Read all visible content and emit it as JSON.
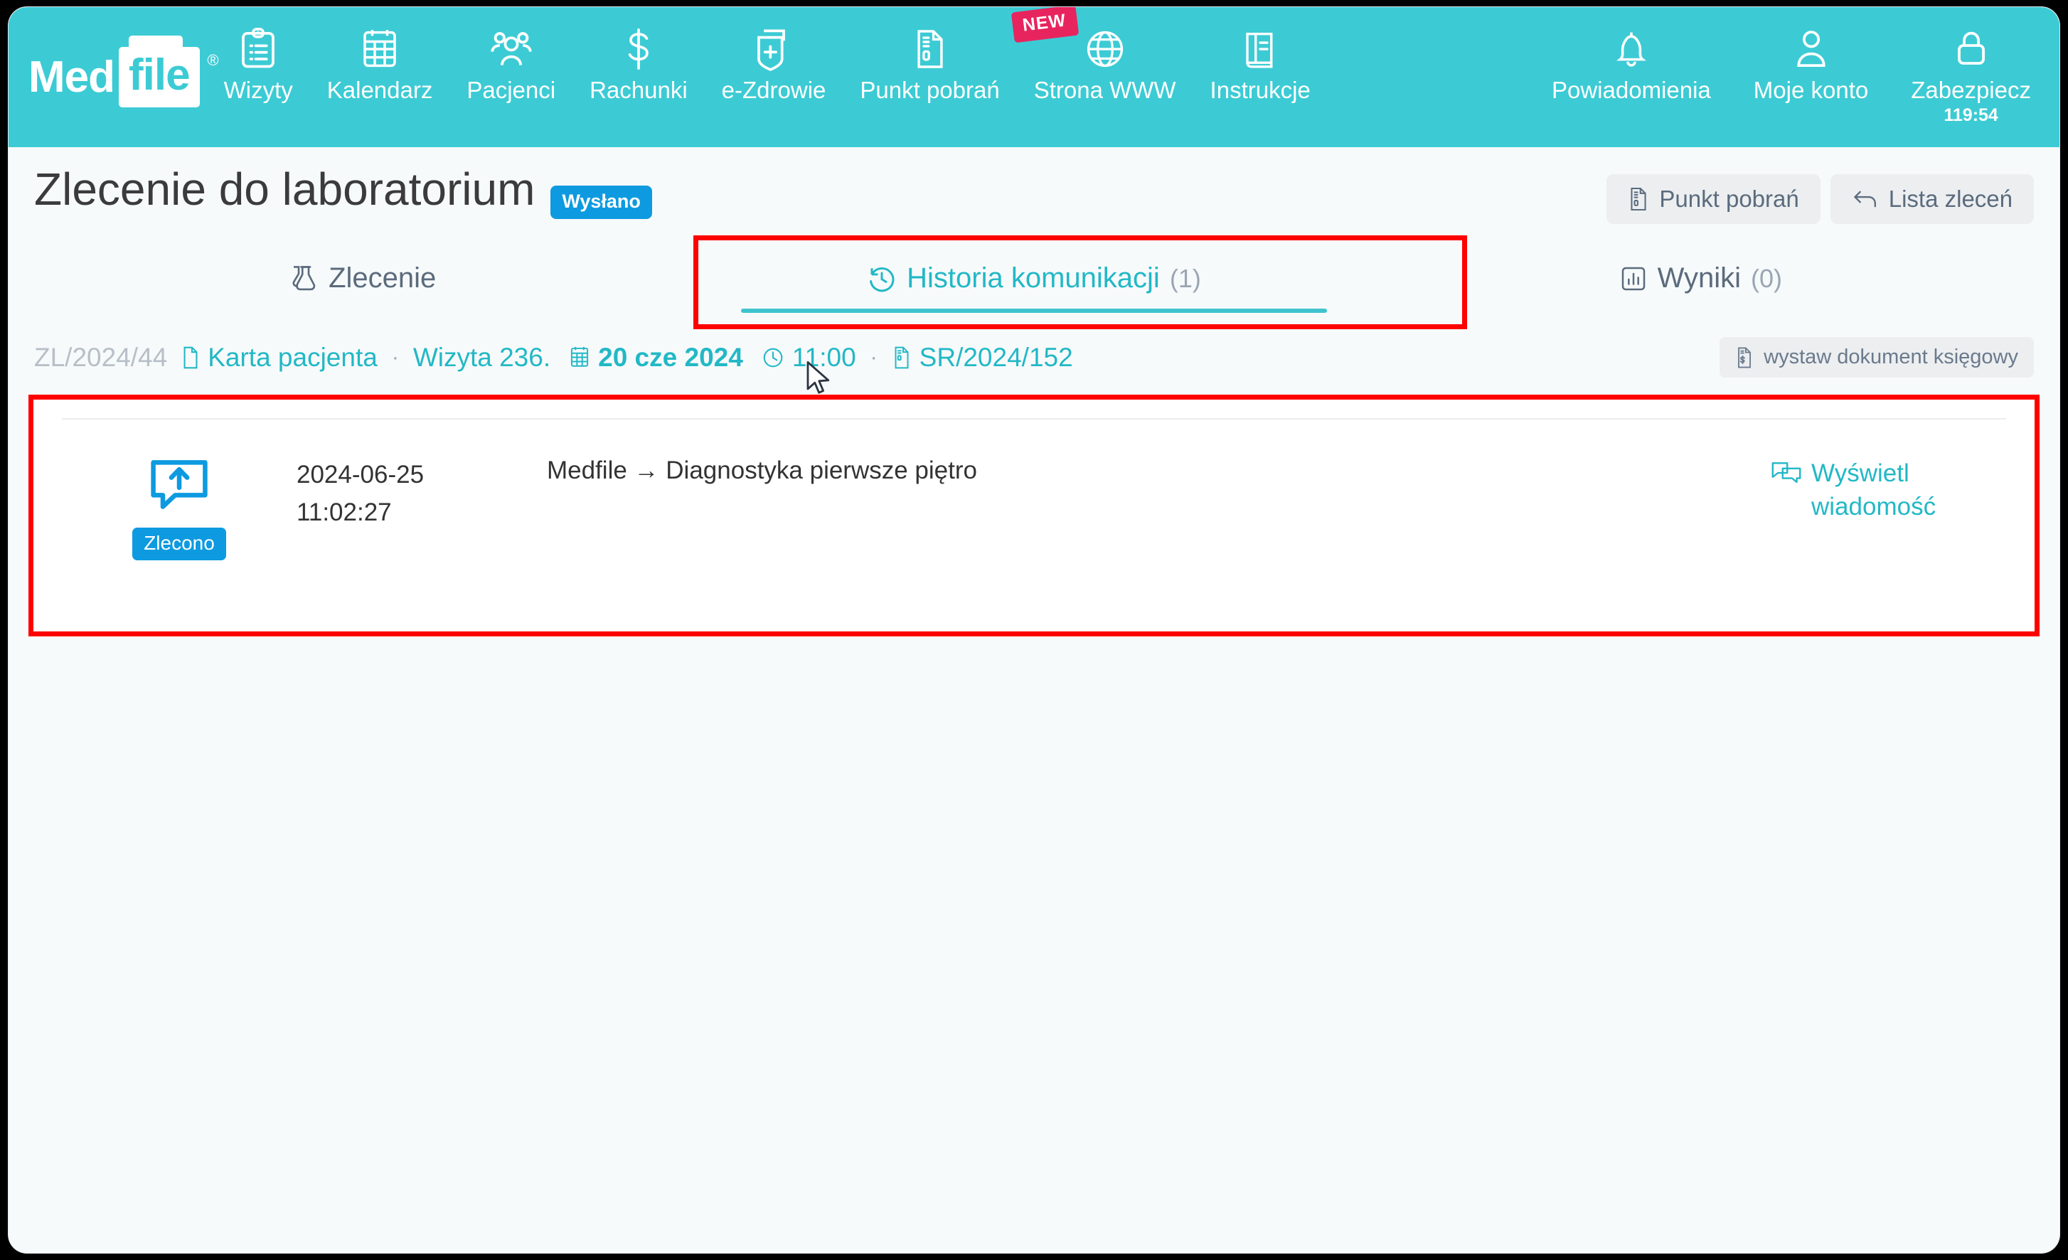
{
  "nav": {
    "logo": {
      "part1": "Med",
      "part2": "file",
      "reg": "®"
    },
    "left_items": [
      {
        "label": "Wizyty",
        "icon": "clipboard-icon"
      },
      {
        "label": "Kalendarz",
        "icon": "calendar-icon"
      },
      {
        "label": "Pacjenci",
        "icon": "users-icon"
      },
      {
        "label": "Rachunki",
        "icon": "dollar-icon"
      },
      {
        "label": "e-Zdrowie",
        "icon": "medical-card-icon"
      },
      {
        "label": "Punkt pobrań",
        "icon": "document-icon"
      },
      {
        "label": "Strona WWW",
        "icon": "globe-icon",
        "badge": "NEW"
      },
      {
        "label": "Instrukcje",
        "icon": "book-icon"
      }
    ],
    "right_items": [
      {
        "label": "Powiadomienia",
        "icon": "bell-icon"
      },
      {
        "label": "Moje konto",
        "icon": "user-icon"
      },
      {
        "label": "Zabezpiecz",
        "icon": "lock-icon",
        "sublabel": "119:54"
      }
    ]
  },
  "header": {
    "title": "Zlecenie do laboratorium",
    "status": "Wysłano",
    "actions": [
      {
        "label": "Punkt pobrań",
        "icon": "document-icon"
      },
      {
        "label": "Lista zleceń",
        "icon": "back-arrow-icon"
      }
    ]
  },
  "tabs": [
    {
      "label": "Zlecenie",
      "count": "",
      "icon": "flask-icon",
      "active": false
    },
    {
      "label": "Historia komunikacji",
      "count": "(1)",
      "icon": "history-icon",
      "active": true
    },
    {
      "label": "Wyniki",
      "count": "(0)",
      "icon": "chart-icon",
      "active": false
    }
  ],
  "meta": {
    "order_id": "ZL/2024/44",
    "patient_card": "Karta pacjenta",
    "separator": "·",
    "visit": "Wizyta 236.",
    "date": "20 cze 2024",
    "time": "11:00",
    "doc_ref": "SR/2024/152",
    "accounting_button": "wystaw dokument księgowy"
  },
  "messages": [
    {
      "status_label": "Zlecono",
      "date": "2024-06-25",
      "time": "11:02:27",
      "route": "Medfile → Diagnostyka pierwsze piętro",
      "action_label": "Wyświetl wiadomość"
    }
  ],
  "colors": {
    "brand_teal": "#3ccbd4",
    "accent_blue": "#0d9ae0",
    "badge_pink": "#e8245f",
    "highlight_red": "#ff0000",
    "link_teal": "#22b8c6"
  }
}
